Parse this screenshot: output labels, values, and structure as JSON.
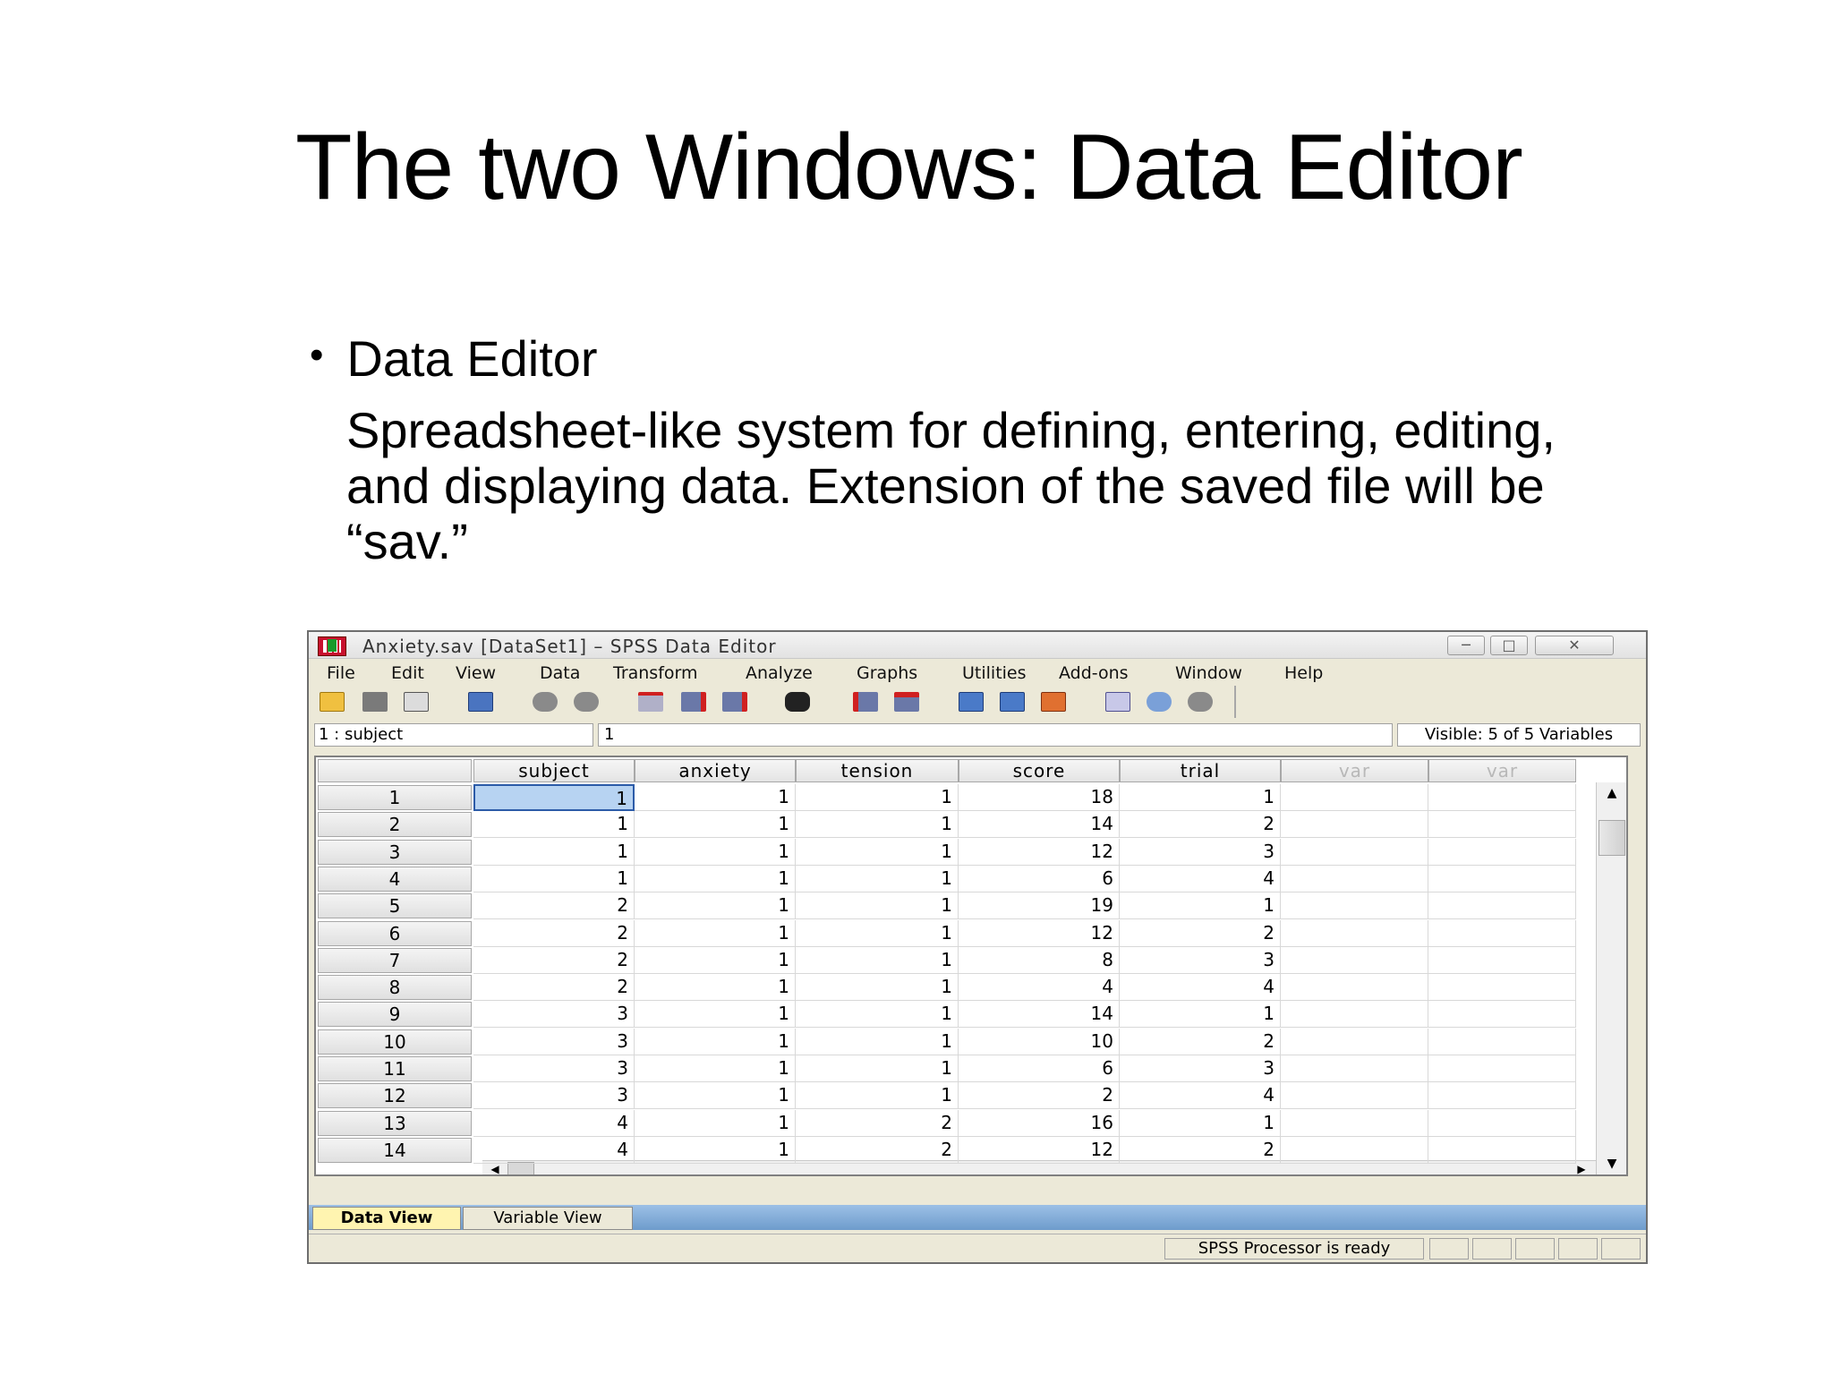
{
  "slide": {
    "title": "The two Windows: Data Editor",
    "bullet": "Data Editor",
    "body_lines": [
      "Spreadsheet-like system for defining, entering, editing,",
      "and displaying data. Extension of the saved file will be",
      "“sav.”"
    ]
  },
  "window": {
    "title": "Anxiety.sav [DataSet1] – SPSS Data Editor",
    "menu": [
      "File",
      "Edit",
      "View",
      "Data",
      "Transform",
      "Analyze",
      "Graphs",
      "Utilities",
      "Add-ons",
      "Window",
      "Help"
    ],
    "cell_ref": "1 : subject",
    "cell_value": "1",
    "visible": "Visible: 5 of 5 Variables",
    "columns": [
      "subject",
      "anxiety",
      "tension",
      "score",
      "trial",
      "var",
      "var"
    ],
    "rows": [
      {
        "n": "1",
        "values": [
          "1",
          "1",
          "1",
          "18",
          "1"
        ]
      },
      {
        "n": "2",
        "values": [
          "1",
          "1",
          "1",
          "14",
          "2"
        ]
      },
      {
        "n": "3",
        "values": [
          "1",
          "1",
          "1",
          "12",
          "3"
        ]
      },
      {
        "n": "4",
        "values": [
          "1",
          "1",
          "1",
          "6",
          "4"
        ]
      },
      {
        "n": "5",
        "values": [
          "2",
          "1",
          "1",
          "19",
          "1"
        ]
      },
      {
        "n": "6",
        "values": [
          "2",
          "1",
          "1",
          "12",
          "2"
        ]
      },
      {
        "n": "7",
        "values": [
          "2",
          "1",
          "1",
          "8",
          "3"
        ]
      },
      {
        "n": "8",
        "values": [
          "2",
          "1",
          "1",
          "4",
          "4"
        ]
      },
      {
        "n": "9",
        "values": [
          "3",
          "1",
          "1",
          "14",
          "1"
        ]
      },
      {
        "n": "10",
        "values": [
          "3",
          "1",
          "1",
          "10",
          "2"
        ]
      },
      {
        "n": "11",
        "values": [
          "3",
          "1",
          "1",
          "6",
          "3"
        ]
      },
      {
        "n": "12",
        "values": [
          "3",
          "1",
          "1",
          "2",
          "4"
        ]
      },
      {
        "n": "13",
        "values": [
          "4",
          "1",
          "2",
          "16",
          "1"
        ]
      },
      {
        "n": "14",
        "values": [
          "4",
          "1",
          "2",
          "12",
          "2"
        ]
      }
    ],
    "tabs": [
      "Data View",
      "Variable View"
    ],
    "status": "SPSS  Processor is ready"
  }
}
